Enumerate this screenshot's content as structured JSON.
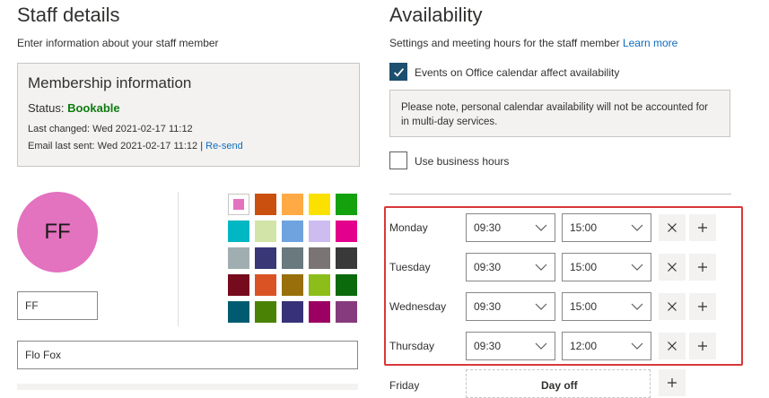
{
  "staff": {
    "title": "Staff details",
    "subtitle": "Enter information about your staff member",
    "membership": {
      "title": "Membership information",
      "status_label": "Status:",
      "status_value": "Bookable",
      "last_changed": "Last changed: Wed 2021-02-17 11:12",
      "email_last_sent": "Email last sent: Wed 2021-02-17 11:12 |",
      "resend_label": "Re-send"
    },
    "avatar_initials": "FF",
    "initials_value": "FF",
    "name_value": "Flo Fox",
    "selected_color": "#e372bf",
    "colors": [
      [
        "#e372bf",
        "#ca5010",
        "#ffaa44",
        "#fce100",
        "#13a10e"
      ],
      [
        "#00b7c3",
        "#d3e4a8",
        "#6fa3df",
        "#cdbcf0",
        "#e3008c"
      ],
      [
        "#a0aeb2",
        "#393775",
        "#69797e",
        "#7a7574",
        "#393939"
      ],
      [
        "#750b1c",
        "#da5325",
        "#986f0b",
        "#8cbd18",
        "#0b6a0b"
      ],
      [
        "#005b70",
        "#498205",
        "#373277",
        "#9b0062",
        "#863b7e"
      ]
    ]
  },
  "availability": {
    "title": "Availability",
    "subtitle": "Settings and meeting hours for the staff member",
    "learn_more": "Learn more",
    "events_checkbox_label": "Events on Office calendar affect availability",
    "events_checked": true,
    "notice": "Please note, personal calendar availability will not be accounted for in multi-day services.",
    "business_hours_label": "Use business hours",
    "business_hours_checked": false,
    "days": [
      {
        "day": "Monday",
        "start": "09:30",
        "end": "15:00"
      },
      {
        "day": "Tuesday",
        "start": "09:30",
        "end": "15:00"
      },
      {
        "day": "Wednesday",
        "start": "09:30",
        "end": "15:00"
      },
      {
        "day": "Thursday",
        "start": "09:30",
        "end": "12:00"
      }
    ],
    "friday": {
      "day": "Friday",
      "status": "Day off"
    },
    "highlight_color": "#d9373a",
    "accent_color": "#1d4f6e"
  }
}
